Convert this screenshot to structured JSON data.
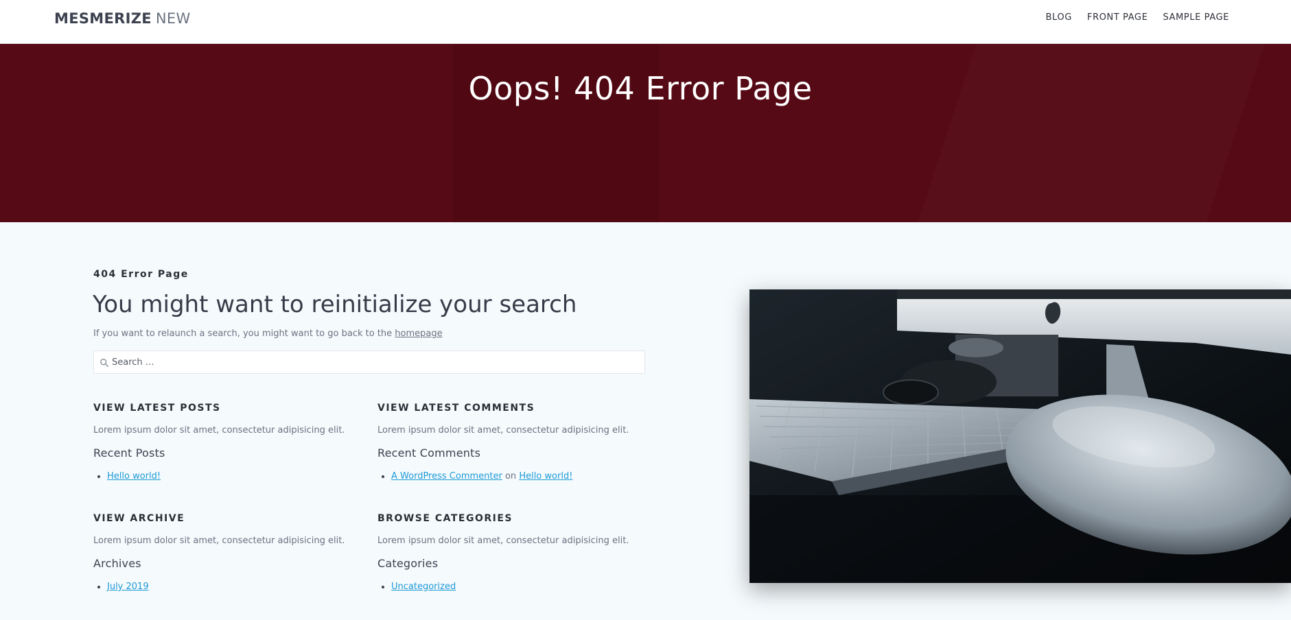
{
  "header": {
    "logo_bold": "MESMERIZE",
    "logo_light": "NEW",
    "nav": [
      "BLOG",
      "FRONT PAGE",
      "SAMPLE PAGE"
    ]
  },
  "hero": {
    "title": "Oops! 404 Error Page"
  },
  "main": {
    "eyebrow": "404 Error Page",
    "heading": "You might want to reinitialize your search",
    "intro_text": "If you want to relaunch a search, you might want to go back to the",
    "intro_link": "homepage",
    "search_placeholder": "Search …"
  },
  "widgets": {
    "latest_posts": {
      "heading": "VIEW LATEST POSTS",
      "desc": "Lorem ipsum dolor sit amet, consectetur adipisicing elit.",
      "subtitle": "Recent Posts",
      "items": [
        "Hello world!"
      ]
    },
    "latest_comments": {
      "heading": "VIEW LATEST COMMENTS",
      "desc": "Lorem ipsum dolor sit amet, consectetur adipisicing elit.",
      "subtitle": "Recent Comments",
      "author": "A WordPress Commenter",
      "on": "on",
      "post": "Hello world!"
    },
    "archive": {
      "heading": "VIEW ARCHIVE",
      "desc": "Lorem ipsum dolor sit amet, consectetur adipisicing elit.",
      "subtitle": "Archives",
      "items": [
        "July 2019"
      ]
    },
    "categories": {
      "heading": "BROWSE CATEGORIES",
      "desc": "Lorem ipsum dolor sit amet, consectetur adipisicing elit.",
      "subtitle": "Categories",
      "items": [
        "Uncategorized"
      ]
    }
  },
  "icons": {
    "search": "search-icon"
  },
  "colors": {
    "hero_bg": "#560a15",
    "page_bg": "#f5fafd",
    "link": "#1d9ad6"
  }
}
